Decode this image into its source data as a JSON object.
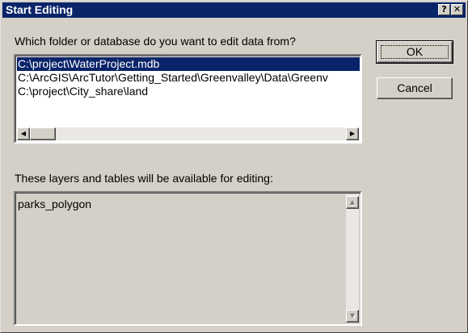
{
  "window": {
    "title": "Start Editing",
    "help_button": "?",
    "close_button": "✕"
  },
  "workspace": {
    "prompt": "Which folder or database do you want to edit data from?",
    "items": [
      {
        "label": "C:\\project\\WaterProject.mdb",
        "selected": true
      },
      {
        "label": "C:\\ArcGIS\\ArcTutor\\Getting_Started\\Greenvalley\\Data\\Greenv",
        "selected": false
      },
      {
        "label": "C:\\project\\City_share\\land",
        "selected": false
      }
    ],
    "scroll_left": "◀",
    "scroll_right": "▶"
  },
  "layers": {
    "prompt": "These layers and tables will be available for editing:",
    "items": [
      "parks_polygon"
    ],
    "scroll_up": "▲",
    "scroll_down": "▼"
  },
  "buttons": {
    "ok": "OK",
    "cancel": "Cancel"
  },
  "colors": {
    "titlebar": "#0a246a",
    "face": "#d4d0c8",
    "selection": "#0a246a"
  }
}
